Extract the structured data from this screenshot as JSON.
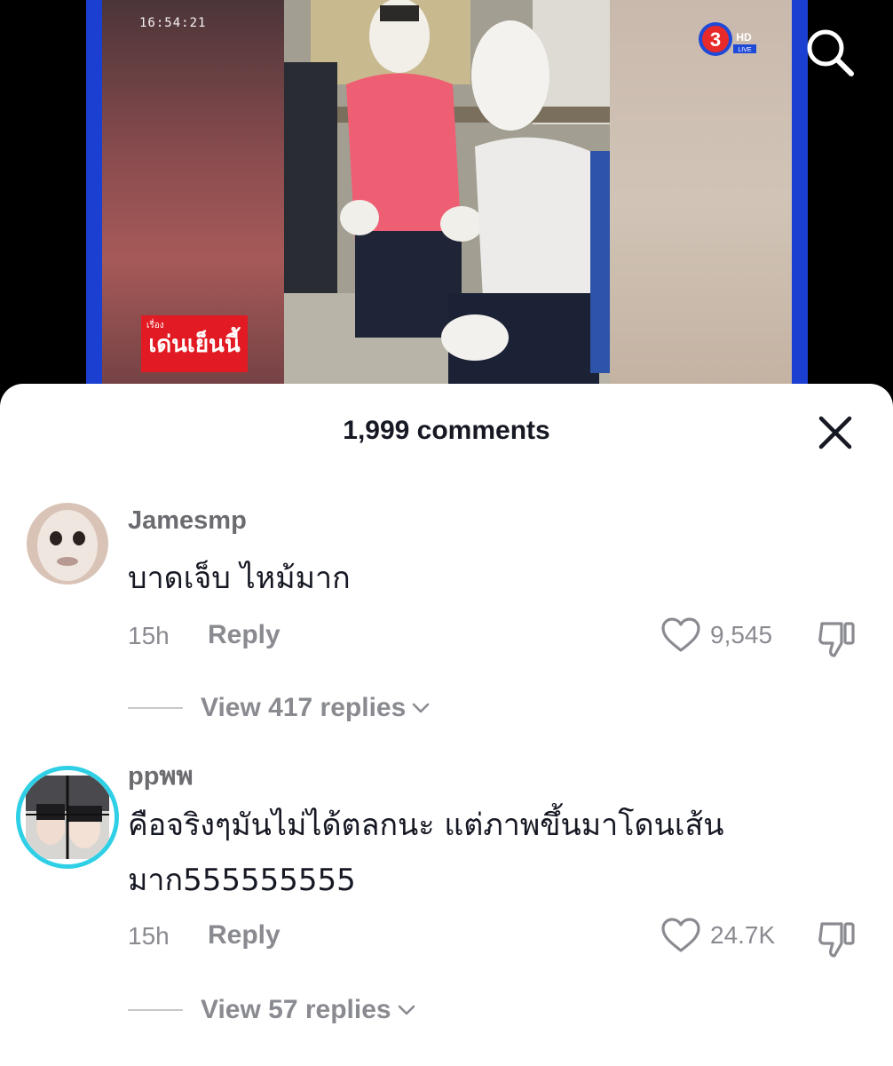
{
  "video": {
    "timestamp": "16:54:21",
    "channel_logo": "3 HD",
    "channel_live": "LIVE",
    "news_badge_top": "เรื่อง",
    "news_badge_text": "เด่นเย็นนี้"
  },
  "top_bar": {
    "search_icon": "search-icon"
  },
  "sheet": {
    "title": "1,999 comments",
    "close_icon": "close-icon"
  },
  "comments": [
    {
      "username": "Jamesmp",
      "text": "บาดเจ็บ ไหม้มาก",
      "time": "15h",
      "reply_label": "Reply",
      "likes": "9,545",
      "view_replies": "View 417 replies"
    },
    {
      "username": "ppพพ",
      "text_line1": "คือจริงๆมันไม่ได้ตลกนะ แต่ภาพขึ้นมาโดนเส้น",
      "text_line2": "มาก555555555",
      "time": "15h",
      "reply_label": "Reply",
      "likes": "24.7K",
      "view_replies": "View 57 replies"
    }
  ],
  "colors": {
    "accent_ring": "#2fd0e6",
    "frame_blue": "#1a3fd1",
    "badge_red": "#e21a23",
    "text_primary": "#161823",
    "text_secondary": "#8a8b91"
  }
}
